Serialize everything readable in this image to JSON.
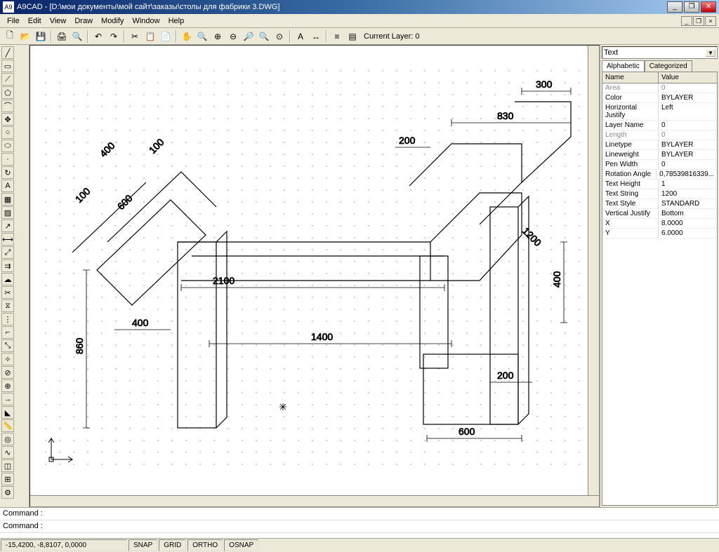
{
  "window": {
    "title": "A9CAD - [D:\\мои документы\\мой сайт\\заказы\\столы для фабрики 3.DWG]"
  },
  "menu": {
    "items": [
      "File",
      "Edit",
      "View",
      "Draw",
      "Modify",
      "Window",
      "Help"
    ]
  },
  "toolbar": {
    "layer_label": "Current Layer: 0"
  },
  "properties": {
    "combo": "Text",
    "tabs": {
      "alpha": "Alphabetic",
      "cat": "Categorized"
    },
    "header": {
      "name": "Name",
      "value": "Value"
    },
    "rows": [
      {
        "name": "Area",
        "value": "0",
        "grey": true
      },
      {
        "name": "Color",
        "value": "BYLAYER"
      },
      {
        "name": "Horizontal Justify",
        "value": "Left"
      },
      {
        "name": "Layer Name",
        "value": "0"
      },
      {
        "name": "Length",
        "value": "0",
        "grey": true
      },
      {
        "name": "Linetype",
        "value": "BYLAYER"
      },
      {
        "name": "Lineweight",
        "value": "BYLAYER"
      },
      {
        "name": "Pen Width",
        "value": "0"
      },
      {
        "name": "Rotation Angle",
        "value": "0,78539816339..."
      },
      {
        "name": "Text Height",
        "value": "1"
      },
      {
        "name": "Text String",
        "value": "1200"
      },
      {
        "name": "Text Style",
        "value": "STANDARD"
      },
      {
        "name": "Vertical Justify",
        "value": "Bottom"
      },
      {
        "name": "X",
        "value": "8.0000"
      },
      {
        "name": "Y",
        "value": "6.0000"
      }
    ]
  },
  "command": {
    "prompt": "Command :"
  },
  "status": {
    "coords": "-15,4200, -8,8107, 0,0000",
    "snap": "SNAP",
    "grid": "GRID",
    "ortho": "ORTHO",
    "osnap": "OSNAP"
  },
  "drawing": {
    "dims": {
      "d300": "300",
      "d830": "830",
      "d400a": "400",
      "d100a": "100",
      "d100b": "100",
      "d600a": "600",
      "d200a": "200",
      "d1200": "1200",
      "d2100": "2100",
      "d400b": "400",
      "d400c": "400",
      "d1400": "1400",
      "d860": "860",
      "d200b": "200",
      "d600b": "600"
    }
  }
}
